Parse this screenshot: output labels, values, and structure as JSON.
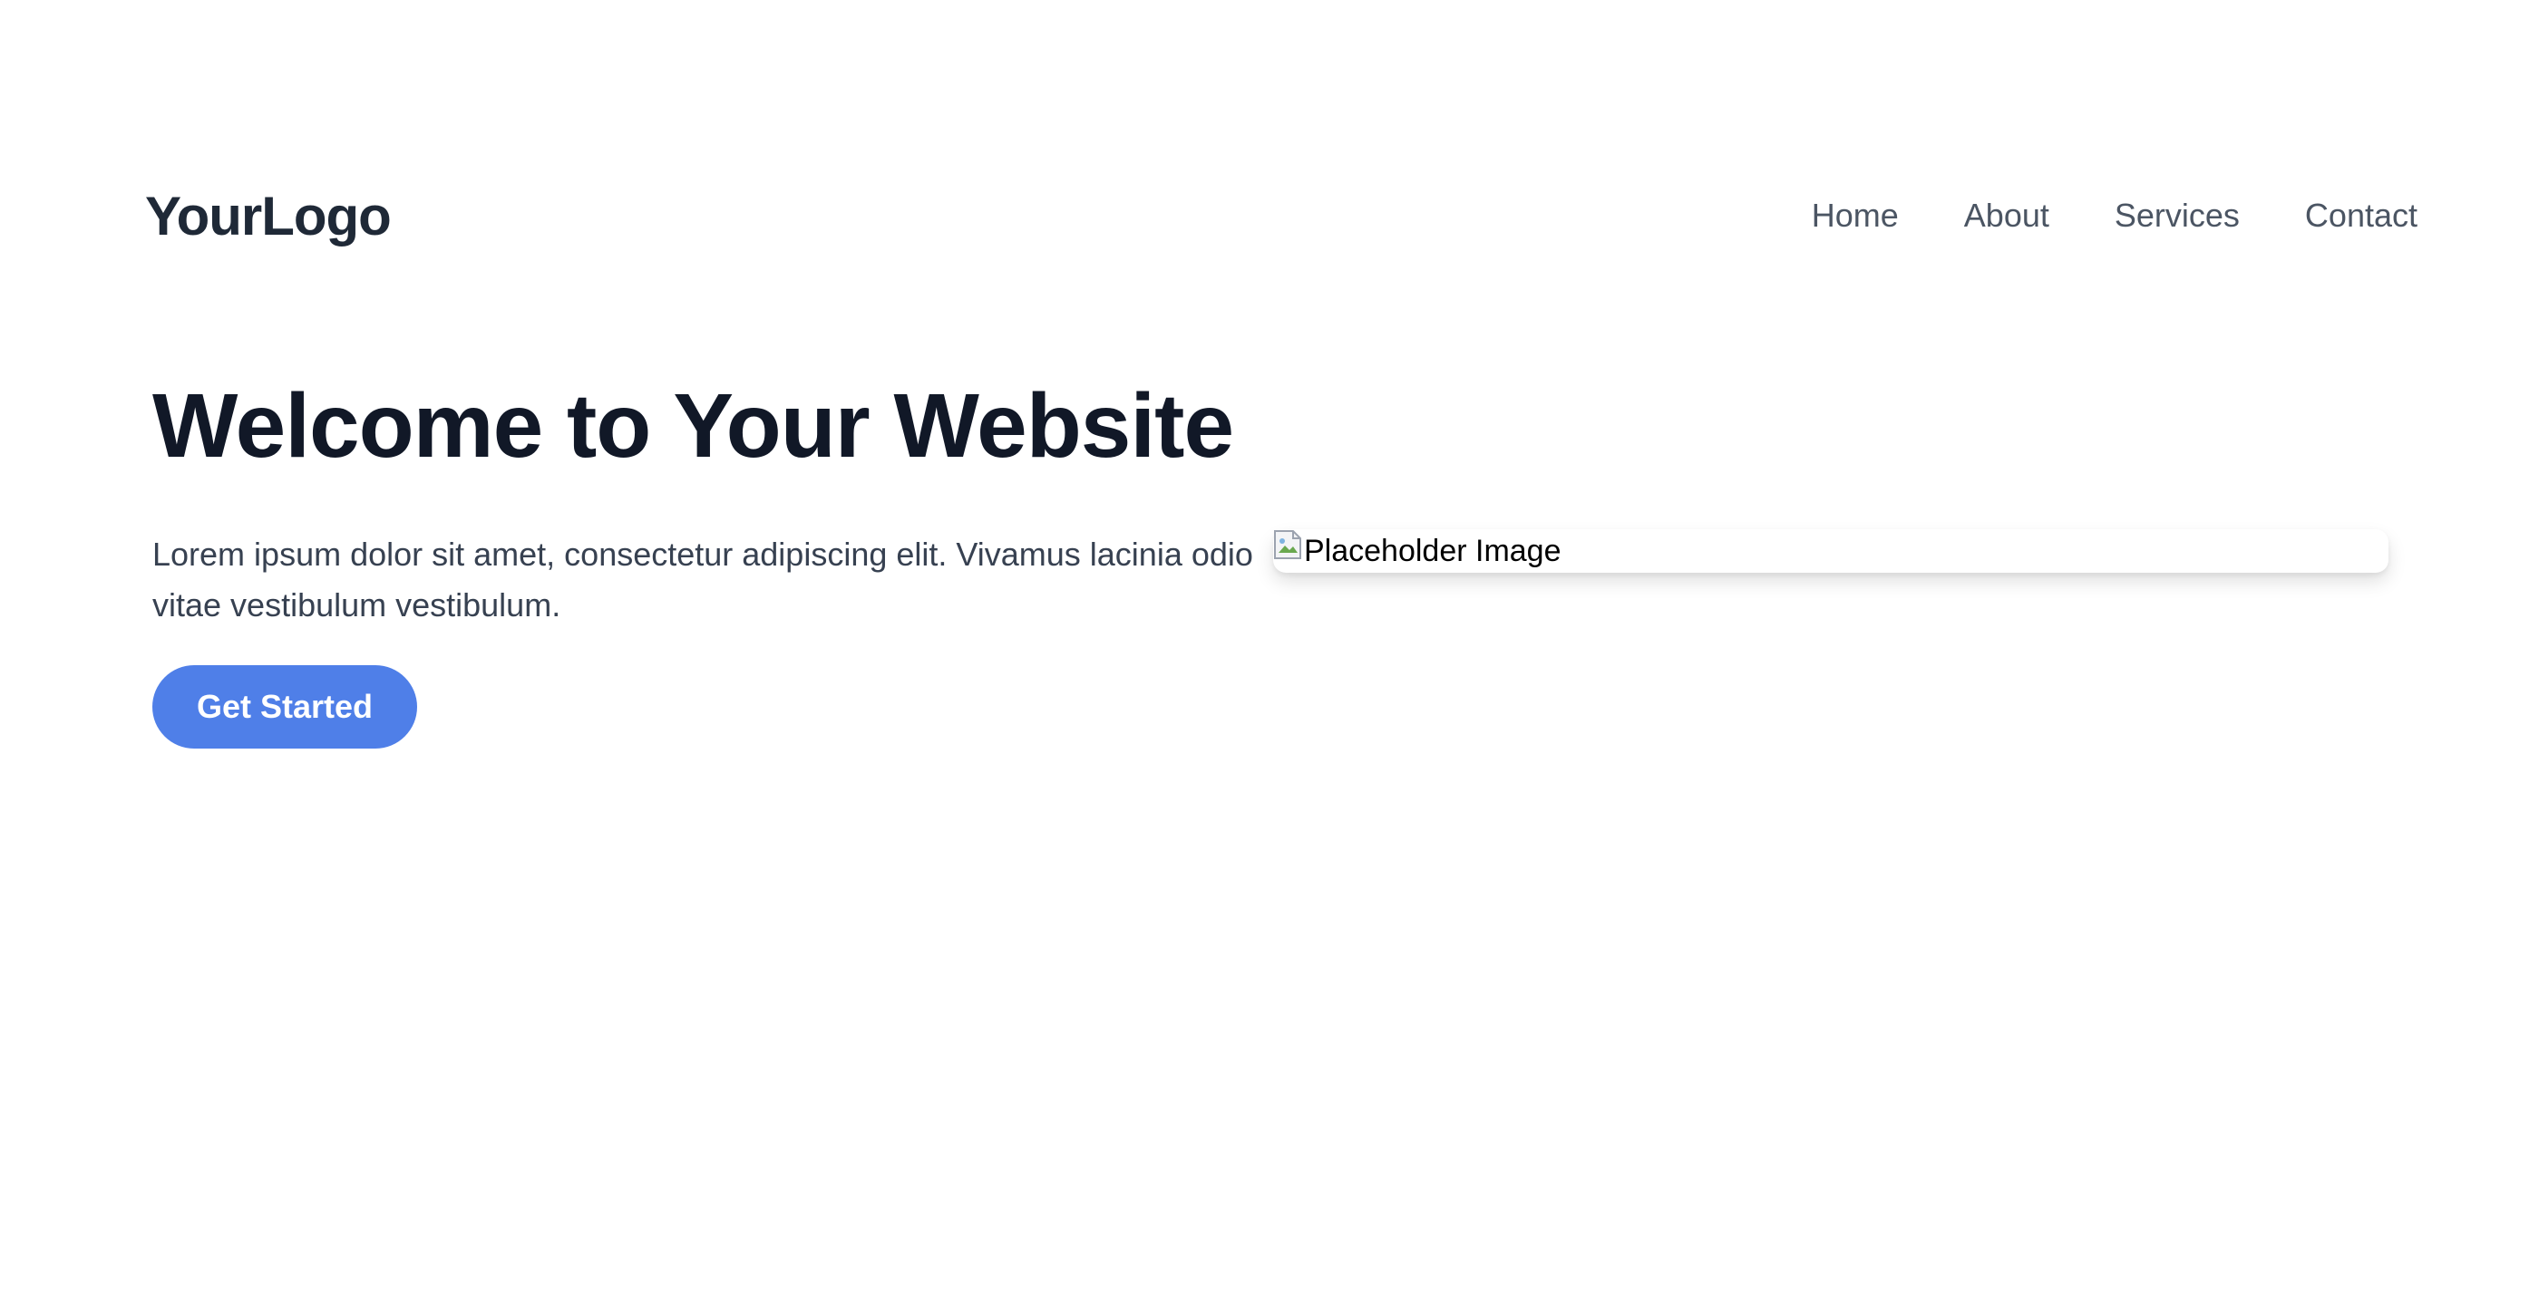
{
  "header": {
    "logo": "YourLogo",
    "nav": [
      {
        "label": "Home"
      },
      {
        "label": "About"
      },
      {
        "label": "Services"
      },
      {
        "label": "Contact"
      }
    ]
  },
  "hero": {
    "title": "Welcome to Your Website",
    "text": "Lorem ipsum dolor sit amet, consectetur adipiscing elit. Vivamus lacinia odio vitae vestibulum vestibulum.",
    "button_label": "Get Started",
    "image_alt": "Placeholder Image",
    "image_icon": "broken-image-icon"
  },
  "colors": {
    "button": "#4f7fe8",
    "title": "#111827",
    "body_text": "#374151",
    "nav_text": "#4b5563"
  }
}
